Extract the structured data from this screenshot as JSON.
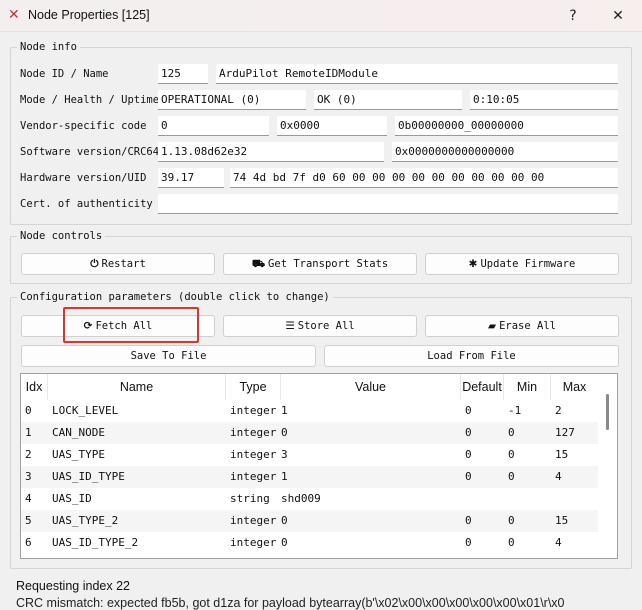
{
  "window": {
    "title": "Node Properties [125]",
    "help": "?",
    "close": "✕"
  },
  "node_info": {
    "title": "Node info",
    "rows": [
      {
        "label": "Node ID / Name",
        "values": [
          "125",
          "ArduPilot RemoteIDModule"
        ]
      },
      {
        "label": "Mode / Health / Uptime",
        "values": [
          "OPERATIONAL (0)",
          "OK (0)",
          "0:10:05"
        ]
      },
      {
        "label": "Vendor-specific code",
        "values": [
          "0",
          "0x0000",
          "0b00000000_00000000"
        ]
      },
      {
        "label": "Software version/CRC64",
        "values": [
          "1.13.08d62e32",
          "0x0000000000000000"
        ]
      },
      {
        "label": "Hardware version/UID",
        "values": [
          "39.17",
          "74 4d bd 7f d0 60 00 00 00 00 00 00 00 00 00 00"
        ]
      },
      {
        "label": "Cert. of authenticity",
        "values": [
          ""
        ]
      }
    ]
  },
  "node_controls": {
    "title": "Node controls",
    "restart": "Restart",
    "transport": "Get Transport Stats",
    "firmware": "Update Firmware"
  },
  "config": {
    "title": "Configuration parameters (double click to change)",
    "fetch": "Fetch All",
    "store": "Store All",
    "erase": "Erase All",
    "save": "Save To File",
    "load": "Load From File",
    "columns": [
      "Idx",
      "Name",
      "Type",
      "Value",
      "Default",
      "Min",
      "Max"
    ],
    "rows": [
      [
        "0",
        "LOCK_LEVEL",
        "integer",
        "1",
        "0",
        "-1",
        "2"
      ],
      [
        "1",
        "CAN_NODE",
        "integer",
        "0",
        "0",
        "0",
        "127"
      ],
      [
        "2",
        "UAS_TYPE",
        "integer",
        "3",
        "0",
        "0",
        "15"
      ],
      [
        "3",
        "UAS_ID_TYPE",
        "integer",
        "1",
        "0",
        "0",
        "4"
      ],
      [
        "4",
        "UAS_ID",
        "string",
        "shd009",
        "",
        "",
        ""
      ],
      [
        "5",
        "UAS_TYPE_2",
        "integer",
        "0",
        "0",
        "0",
        "15"
      ],
      [
        "6",
        "UAS_ID_TYPE_2",
        "integer",
        "0",
        "0",
        "0",
        "4"
      ]
    ]
  },
  "status": "Requesting index 22",
  "log": "CRC mismatch: expected fb5b, got d1za for payload bytearray(b'\\x02\\x00\\x00\\x00\\x00\\x00\\x01\\r\\x0",
  "colors": {
    "highlight": "#e8302a"
  }
}
